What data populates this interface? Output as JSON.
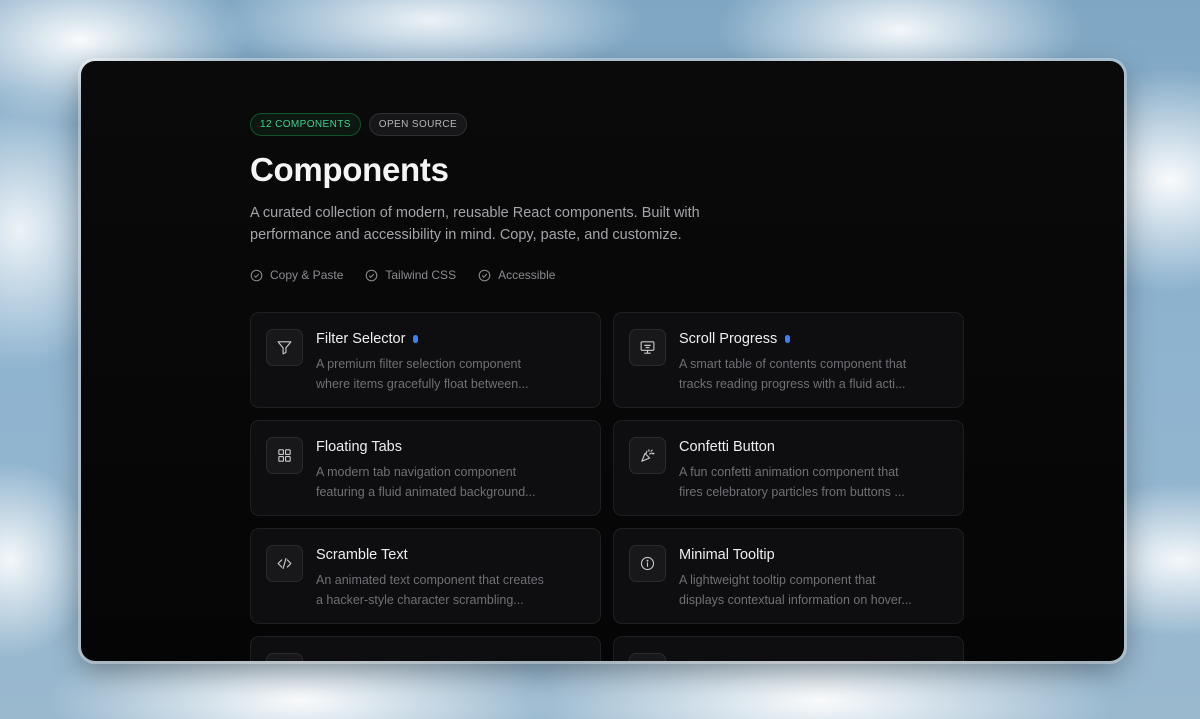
{
  "badges": {
    "count": "12 COMPONENTS",
    "license": "OPEN SOURCE"
  },
  "header": {
    "title": "Components",
    "description": "A curated collection of modern, reusable React components. Built with performance and accessibility in mind. Copy, paste, and customize."
  },
  "features": [
    {
      "label": "Copy & Paste",
      "icon": "check-circle-icon"
    },
    {
      "label": "Tailwind CSS",
      "icon": "check-circle-icon"
    },
    {
      "label": "Accessible",
      "icon": "check-circle-icon"
    }
  ],
  "cards": [
    {
      "title": "Filter Selector",
      "line1": "A premium filter selection component",
      "line2": "where items gracefully float between...",
      "icon": "filter-icon",
      "is_new": true
    },
    {
      "title": "Scroll Progress",
      "line1": "A smart table of contents component that",
      "line2": "tracks reading progress with a fluid acti...",
      "icon": "monitor-icon",
      "is_new": true
    },
    {
      "title": "Floating Tabs",
      "line1": "A modern tab navigation component",
      "line2": "featuring a fluid animated background...",
      "icon": "grid-icon",
      "is_new": false
    },
    {
      "title": "Confetti Button",
      "line1": "A fun confetti animation component that",
      "line2": "fires celebratory particles from buttons ...",
      "icon": "party-popper-icon",
      "is_new": false
    },
    {
      "title": "Scramble Text",
      "line1": "An animated text component that creates",
      "line2": "a hacker-style character scrambling...",
      "icon": "code-icon",
      "is_new": false
    },
    {
      "title": "Minimal Tooltip",
      "line1": "A lightweight tooltip component that",
      "line2": "displays contextual information on hover...",
      "icon": "info-icon",
      "is_new": false
    },
    {
      "title": "",
      "line1": "",
      "line2": "",
      "icon": "",
      "is_new": false
    },
    {
      "title": "",
      "line1": "",
      "line2": "",
      "icon": "",
      "is_new": false
    }
  ],
  "colors": {
    "accent_green": "#3ecf8e",
    "new_dot_blue": "#3b82f6",
    "window_bg": "#050505"
  }
}
